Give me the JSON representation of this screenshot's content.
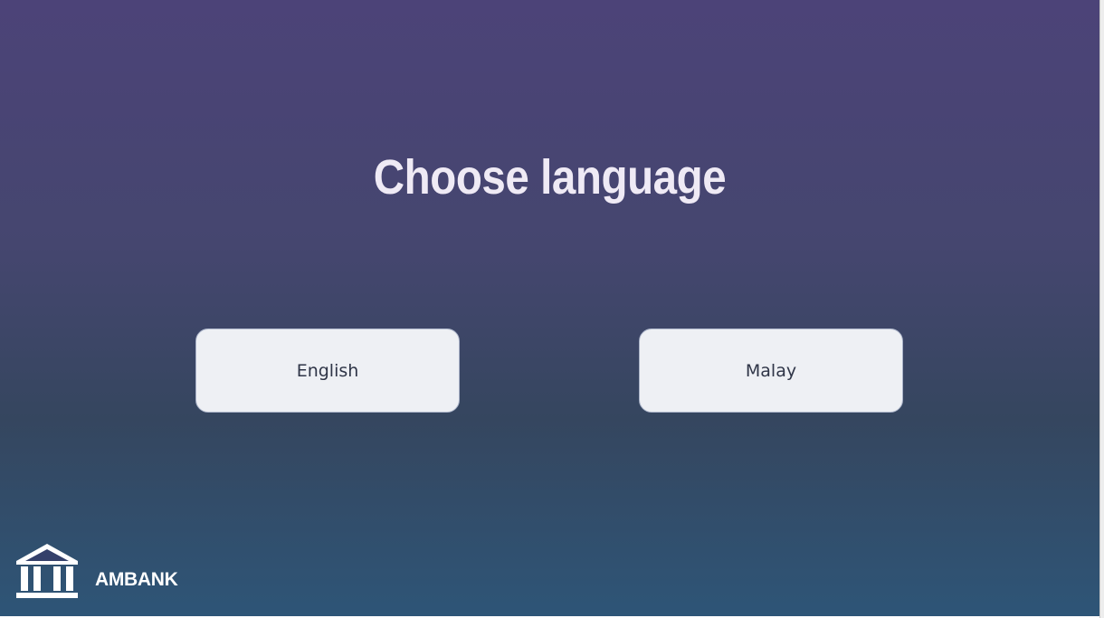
{
  "screen": {
    "title": "Choose language"
  },
  "languages": {
    "english_label": "English",
    "malay_label": "Malay"
  },
  "footer": {
    "bank_name": "AMBANK",
    "bank_icon": "bank-building-icon"
  },
  "colors": {
    "background_top": "#4c4378",
    "background_bottom": "#2e5577",
    "button_fill": "#eef0f4",
    "title_text": "#efeaf5"
  }
}
